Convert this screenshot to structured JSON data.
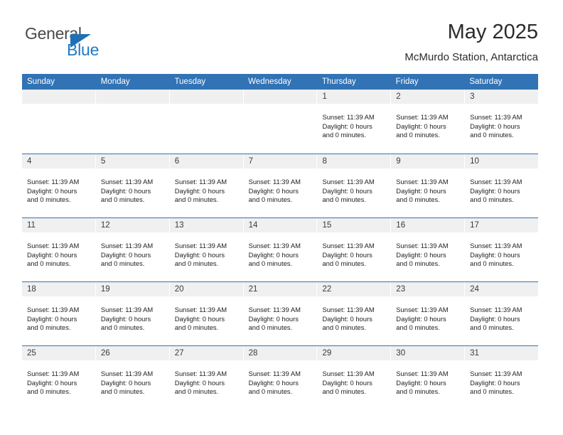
{
  "brand": {
    "name_part1": "General",
    "name_part2": "Blue",
    "triangle_color": "#1f6fb5",
    "blue_color": "#1f7ac4"
  },
  "header": {
    "title": "May 2025",
    "subtitle": "McMurdo Station, Antarctica"
  },
  "theme": {
    "header_blue": "#3173b4",
    "daynum_band": "#f0f0f0",
    "row_divider": "#3173b4"
  },
  "weekdays": [
    "Sunday",
    "Monday",
    "Tuesday",
    "Wednesday",
    "Thursday",
    "Friday",
    "Saturday"
  ],
  "day_info": {
    "sunset": "Sunset: 11:39 AM",
    "daylight_line1": "Daylight: 0 hours",
    "daylight_line2": "and 0 minutes."
  },
  "weeks": [
    [
      {
        "day": "",
        "empty": true
      },
      {
        "day": "",
        "empty": true
      },
      {
        "day": "",
        "empty": true
      },
      {
        "day": "",
        "empty": true
      },
      {
        "day": "1",
        "empty": false
      },
      {
        "day": "2",
        "empty": false
      },
      {
        "day": "3",
        "empty": false
      }
    ],
    [
      {
        "day": "4",
        "empty": false
      },
      {
        "day": "5",
        "empty": false
      },
      {
        "day": "6",
        "empty": false
      },
      {
        "day": "7",
        "empty": false
      },
      {
        "day": "8",
        "empty": false
      },
      {
        "day": "9",
        "empty": false
      },
      {
        "day": "10",
        "empty": false
      }
    ],
    [
      {
        "day": "11",
        "empty": false
      },
      {
        "day": "12",
        "empty": false
      },
      {
        "day": "13",
        "empty": false
      },
      {
        "day": "14",
        "empty": false
      },
      {
        "day": "15",
        "empty": false
      },
      {
        "day": "16",
        "empty": false
      },
      {
        "day": "17",
        "empty": false
      }
    ],
    [
      {
        "day": "18",
        "empty": false
      },
      {
        "day": "19",
        "empty": false
      },
      {
        "day": "20",
        "empty": false
      },
      {
        "day": "21",
        "empty": false
      },
      {
        "day": "22",
        "empty": false
      },
      {
        "day": "23",
        "empty": false
      },
      {
        "day": "24",
        "empty": false
      }
    ],
    [
      {
        "day": "25",
        "empty": false
      },
      {
        "day": "26",
        "empty": false
      },
      {
        "day": "27",
        "empty": false
      },
      {
        "day": "28",
        "empty": false
      },
      {
        "day": "29",
        "empty": false
      },
      {
        "day": "30",
        "empty": false
      },
      {
        "day": "31",
        "empty": false
      }
    ]
  ]
}
